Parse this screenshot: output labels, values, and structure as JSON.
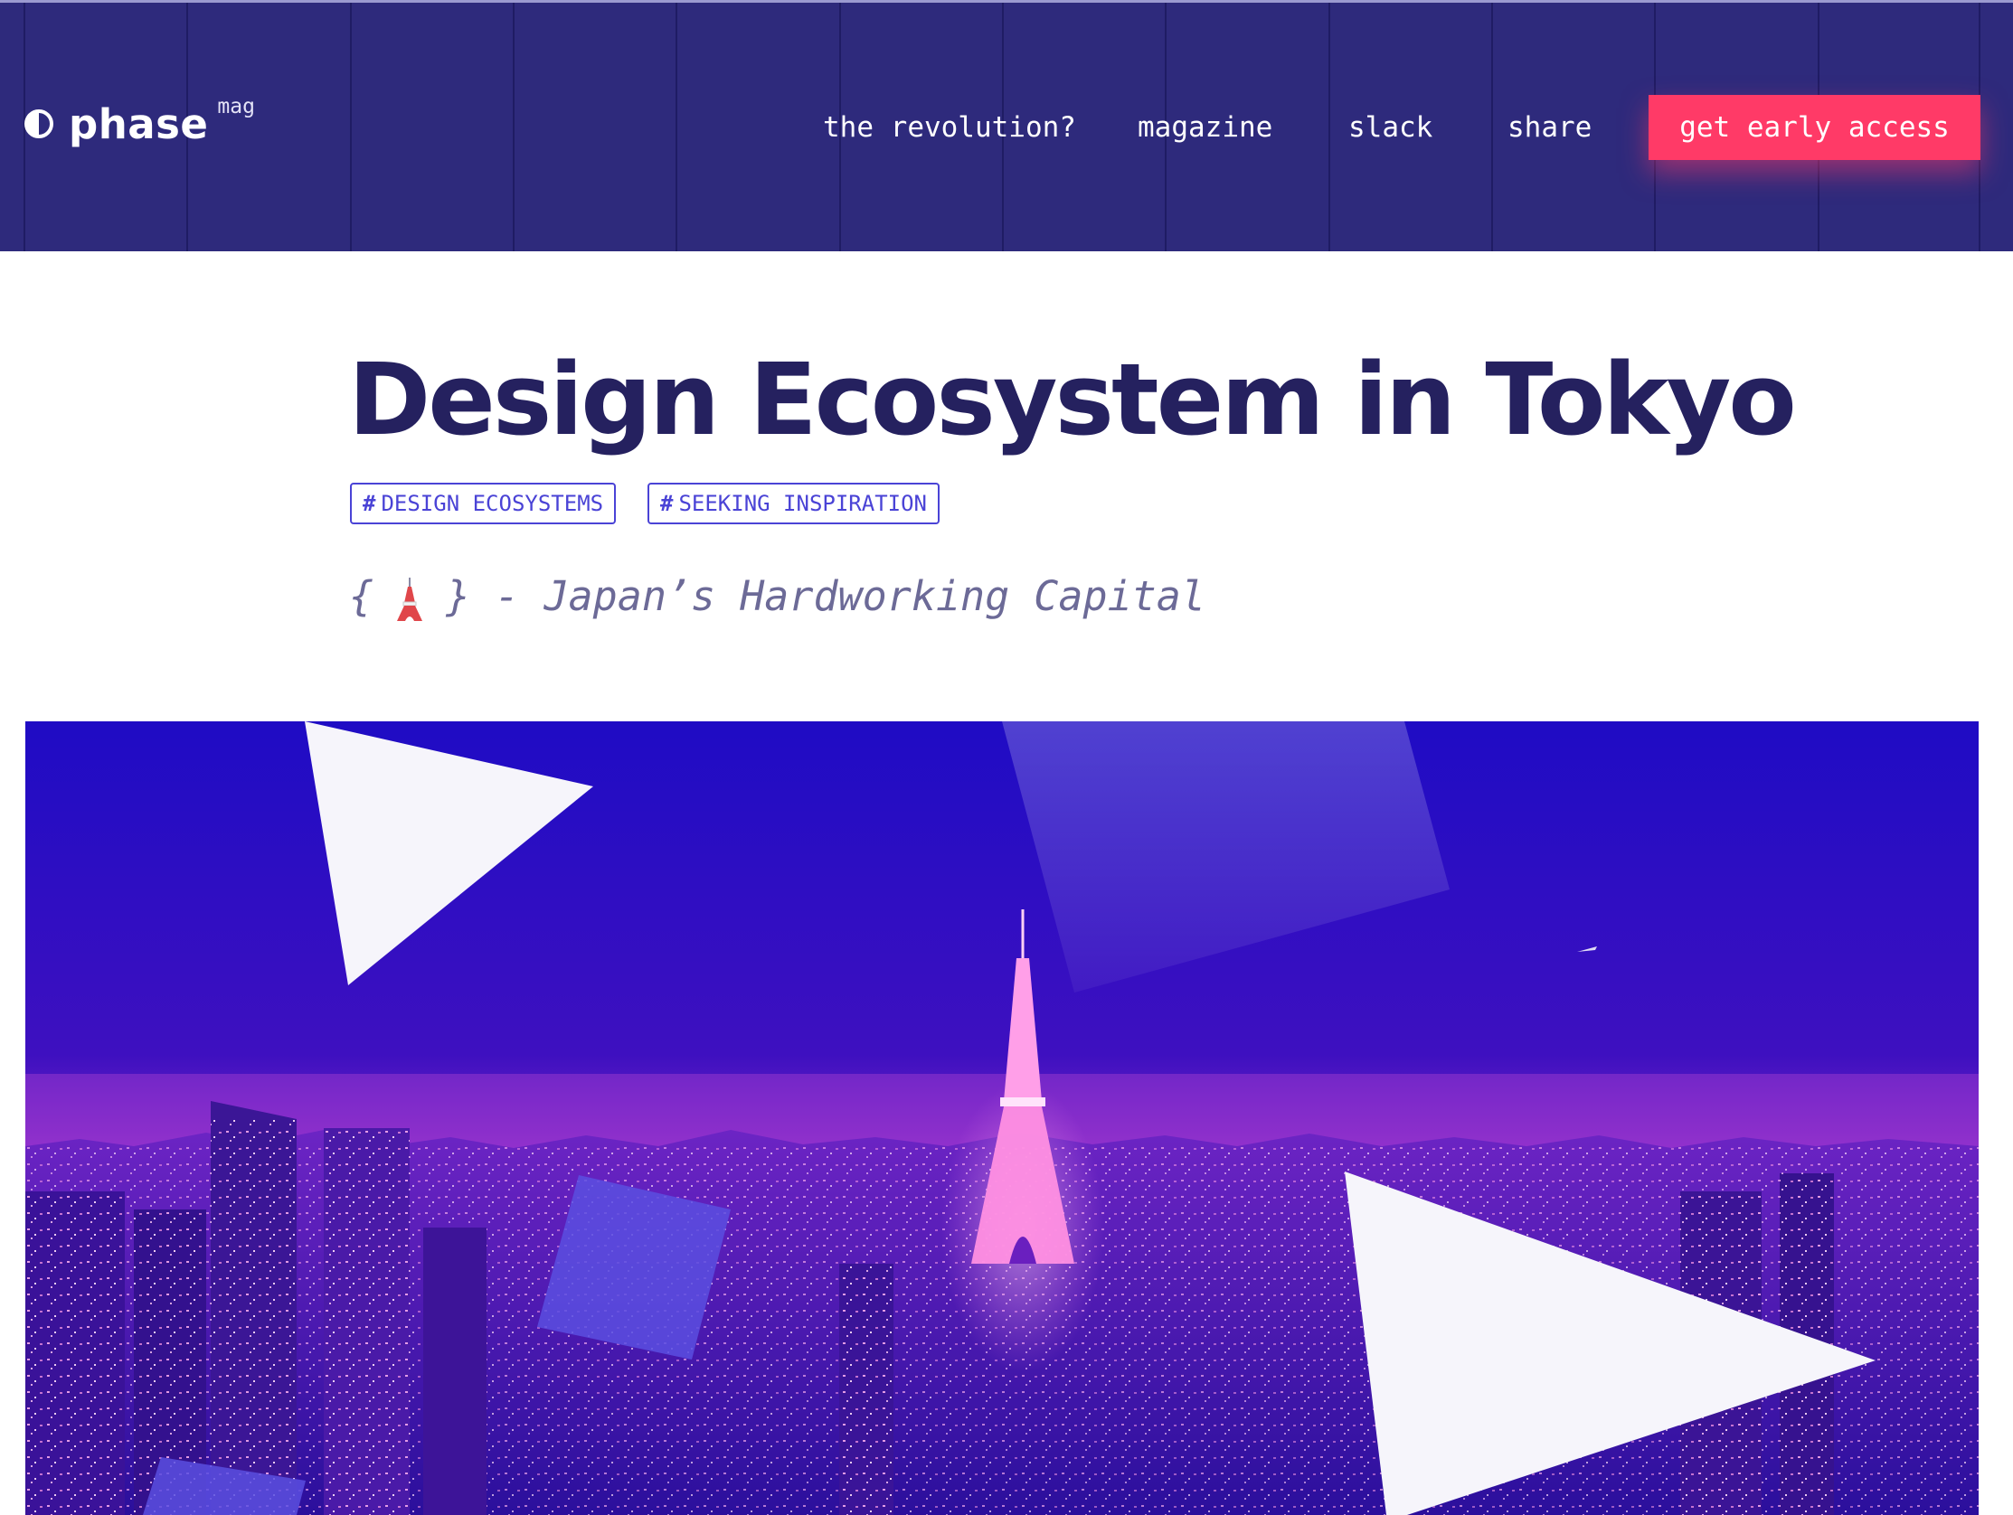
{
  "brand": {
    "logo_icon": "half-circle-icon",
    "name": "phase",
    "superscript": "mag"
  },
  "nav": {
    "items": [
      {
        "label": "the revolution?"
      },
      {
        "label": "magazine"
      },
      {
        "label": "slack"
      },
      {
        "label": "share"
      }
    ],
    "cta_label": "get early access"
  },
  "article": {
    "title": "Design Ecosystem in Tokyo",
    "tags": [
      {
        "label": "DESIGN ECOSYSTEMS"
      },
      {
        "label": "SEEKING INSPIRATION"
      }
    ],
    "subtitle": {
      "open": "{",
      "icon": "tokyo-tower-icon",
      "close": "}",
      "text": "- Japan’s Hardworking Capital"
    },
    "hero_image": "tokyo-night-skyline-image"
  },
  "colors": {
    "header_bg": "#2e2a7c",
    "accent": "#ff3a67",
    "title": "#25215f",
    "tag": "#4a43d6",
    "subtitle": "#6c6a97"
  }
}
